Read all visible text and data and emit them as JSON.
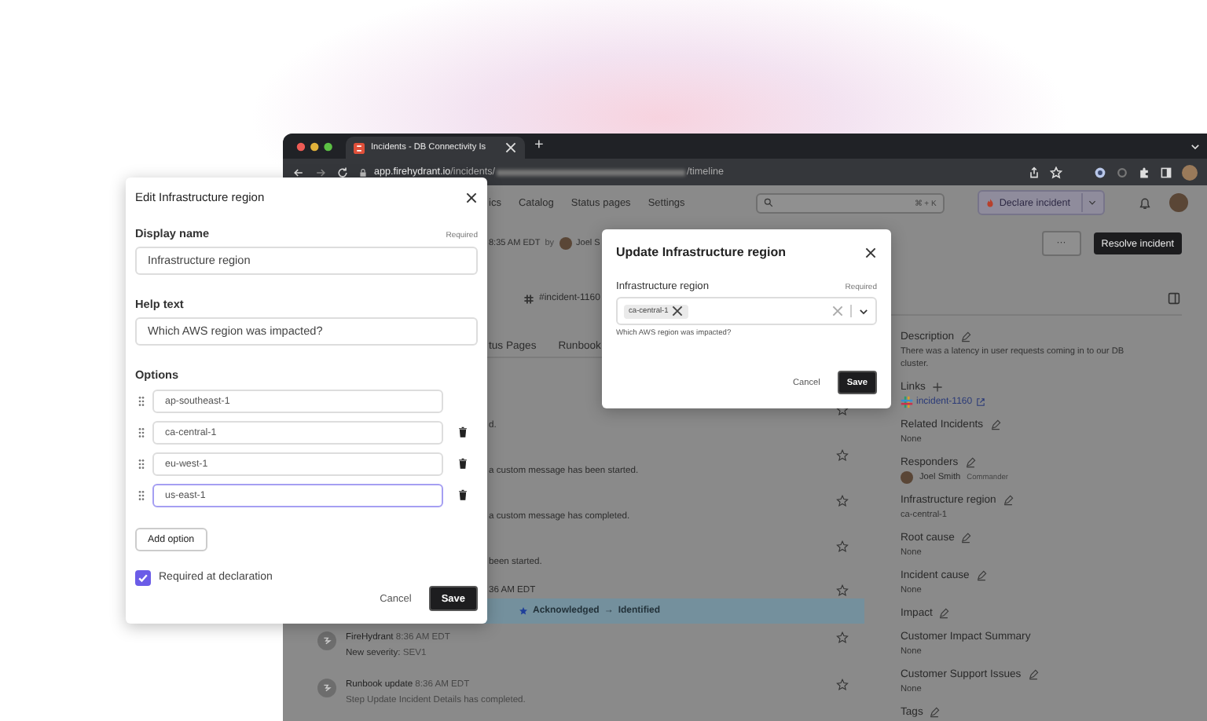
{
  "browser": {
    "tab_title": "Incidents - DB Connectivity Is",
    "new_tab": "+",
    "url_host": "app.firehydrant.io",
    "url_path": "/incidents/",
    "url_end": "/timeline"
  },
  "app": {
    "nav": [
      "ics",
      "Catalog",
      "Status pages",
      "Settings"
    ],
    "search": {
      "shortcut": "⌘ + K"
    },
    "declare_button": "Declare incident",
    "header": {
      "time": "8:35 AM EDT",
      "by": "by",
      "user": "Joel S"
    },
    "more_button": "···",
    "resolve_button": "Resolve incident",
    "channel": "#incident-1160",
    "tabs": [
      "tus Pages",
      "Runbook"
    ],
    "timeline": [
      {
        "kind": "text",
        "text": "d."
      },
      {
        "kind": "text",
        "text": "a custom message has been started."
      },
      {
        "kind": "text",
        "text": "a custom message has completed."
      },
      {
        "kind": "text",
        "text": "been started."
      },
      {
        "kind": "title",
        "text": "36 AM EDT"
      },
      {
        "kind": "banner",
        "from": "Acknowledged",
        "arrow": "→",
        "to": "Identified"
      },
      {
        "kind": "event",
        "author": "FireHydrant",
        "time": "8:36 AM EDT",
        "detail_label": "New severity:",
        "detail_value": "SEV1"
      },
      {
        "kind": "event",
        "author": "Runbook update",
        "time": "8:36 AM EDT",
        "detail": "Step Update Incident Details has completed."
      }
    ],
    "sidebar": [
      {
        "label": "Description",
        "editable": true,
        "addable": false,
        "kind": "text",
        "value": "There was a latency in user requests coming in to our DB cluster."
      },
      {
        "label": "Links",
        "editable": false,
        "addable": true,
        "kind": "link",
        "value": "incident-1160"
      },
      {
        "label": "Related Incidents",
        "editable": true,
        "addable": false,
        "kind": "text",
        "value": "None"
      },
      {
        "label": "Responders",
        "editable": true,
        "addable": false,
        "kind": "person",
        "value": "Joel Smith",
        "role": "Commander"
      },
      {
        "label": "Infrastructure region",
        "editable": true,
        "addable": false,
        "kind": "text",
        "value": "ca-central-1"
      },
      {
        "label": "Root cause",
        "editable": true,
        "addable": false,
        "kind": "text",
        "value": "None"
      },
      {
        "label": "Incident cause",
        "editable": true,
        "addable": false,
        "kind": "text",
        "value": "None"
      },
      {
        "label": "Impact",
        "editable": true,
        "addable": false,
        "kind": "empty"
      },
      {
        "label": "Customer Impact Summary",
        "editable": false,
        "addable": false,
        "kind": "text",
        "value": "None"
      },
      {
        "label": "Customer Support Issues",
        "editable": true,
        "addable": false,
        "kind": "text",
        "value": "None"
      },
      {
        "label": "Tags",
        "editable": true,
        "addable": false,
        "kind": "empty"
      }
    ]
  },
  "edit_dialog": {
    "title": "Edit Infrastructure region",
    "display_name": {
      "label": "Display name",
      "required": "Required",
      "value": "Infrastructure region"
    },
    "help_text": {
      "label": "Help text",
      "value": "Which AWS region was impacted?"
    },
    "options_label": "Options",
    "options": [
      {
        "value": "ap-southeast-1",
        "deletable": false,
        "focused": false
      },
      {
        "value": "ca-central-1",
        "deletable": true,
        "focused": false
      },
      {
        "value": "eu-west-1",
        "deletable": true,
        "focused": false
      },
      {
        "value": "us-east-1",
        "deletable": true,
        "focused": true
      }
    ],
    "add_option": "Add option",
    "required_checkbox": {
      "label": "Required at declaration",
      "checked": true
    },
    "cancel": "Cancel",
    "save": "Save"
  },
  "update_dialog": {
    "title": "Update Infrastructure region",
    "field_label": "Infrastructure region",
    "required": "Required",
    "chips": [
      "ca-central-1"
    ],
    "help": "Which AWS region was impacted?",
    "cancel": "Cancel",
    "save": "Save"
  }
}
